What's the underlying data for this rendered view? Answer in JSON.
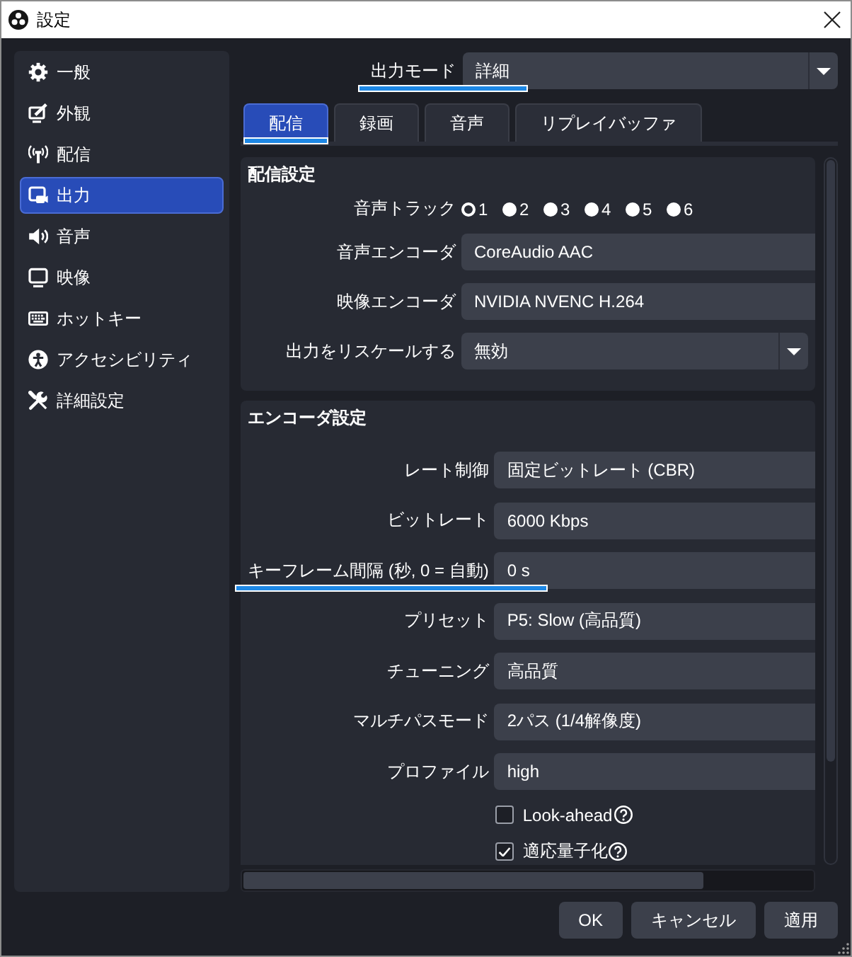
{
  "window": {
    "title": "設定"
  },
  "sidebar": {
    "items": [
      {
        "label": "一般",
        "selected": false
      },
      {
        "label": "外観",
        "selected": false
      },
      {
        "label": "配信",
        "selected": false
      },
      {
        "label": "出力",
        "selected": true
      },
      {
        "label": "音声",
        "selected": false
      },
      {
        "label": "映像",
        "selected": false
      },
      {
        "label": "ホットキー",
        "selected": false
      },
      {
        "label": "アクセシビリティ",
        "selected": false
      },
      {
        "label": "詳細設定",
        "selected": false
      }
    ]
  },
  "output_mode": {
    "label": "出力モード",
    "value": "詳細",
    "underlined": true
  },
  "tabs": [
    {
      "label": "配信",
      "selected": true,
      "underlined": true
    },
    {
      "label": "録画",
      "selected": false,
      "underlined": false
    },
    {
      "label": "音声",
      "selected": false,
      "underlined": false
    },
    {
      "label": "リプレイバッファ",
      "selected": false,
      "underlined": false
    }
  ],
  "stream_settings": {
    "title": "配信設定",
    "audio_track": {
      "label": "音声トラック",
      "options": [
        {
          "label": "1",
          "selected": true
        },
        {
          "label": "2",
          "selected": false
        },
        {
          "label": "3",
          "selected": false
        },
        {
          "label": "4",
          "selected": false
        },
        {
          "label": "5",
          "selected": false
        },
        {
          "label": "6",
          "selected": false
        }
      ]
    },
    "rows": [
      {
        "kind": "field",
        "label": "音声エンコーダ",
        "value": "CoreAudio AAC"
      },
      {
        "kind": "field",
        "label": "映像エンコーダ",
        "value": "NVIDIA NVENC H.264"
      },
      {
        "kind": "dropdown",
        "label": "出力をリスケールする",
        "value": "無効"
      }
    ]
  },
  "encoder_settings": {
    "title": "エンコーダ設定",
    "rows": [
      {
        "kind": "field",
        "label": "レート制御",
        "value": "固定ビットレート (CBR)",
        "underlined": false
      },
      {
        "kind": "field",
        "label": "ビットレート",
        "value": "6000 Kbps",
        "underlined": false
      },
      {
        "kind": "field",
        "label": "キーフレーム間隔 (秒, 0 = 自動)",
        "value": "0 s",
        "underlined": true
      },
      {
        "kind": "field",
        "label": "プリセット",
        "value": "P5: Slow (高品質)",
        "underlined": false
      },
      {
        "kind": "field",
        "label": "チューニング",
        "value": "高品質",
        "underlined": false
      },
      {
        "kind": "field",
        "label": "マルチパスモード",
        "value": "2パス (1/4解像度)",
        "underlined": false
      },
      {
        "kind": "field",
        "label": "プロファイル",
        "value": "high",
        "underlined": false
      },
      {
        "kind": "checkbox",
        "label": "Look-ahead",
        "checked": false,
        "underlined": false
      },
      {
        "kind": "checkbox",
        "label": "適応量子化",
        "checked": true,
        "underlined": false
      }
    ]
  },
  "buttons": [
    {
      "label": "OK"
    },
    {
      "label": "キャンセル"
    },
    {
      "label": "適用"
    }
  ]
}
